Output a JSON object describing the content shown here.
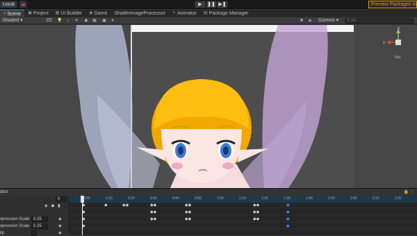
{
  "toolbar": {
    "local_label": "Local",
    "cloud_icon": "cloud-icon",
    "play_icon": "▶",
    "pause_icon": "❚❚",
    "step_icon": "▶❚",
    "preview_label": "Preview Packages in Us"
  },
  "tabs": [
    {
      "label": "Scene",
      "icon": "#"
    },
    {
      "label": "Project",
      "icon": "▣"
    },
    {
      "label": "UI Builder",
      "icon": "▦"
    },
    {
      "label": "Game",
      "icon": "◉"
    },
    {
      "label": "ShaderImageProcessor",
      "icon": ""
    },
    {
      "label": "Animator",
      "icon": "✎"
    },
    {
      "label": "Package Manager",
      "icon": "▤"
    }
  ],
  "scenebar": {
    "shading_mode": "Shaded",
    "mode_2d": "2D",
    "gizmos_label": "Gizmos",
    "search_placeholder": "All"
  },
  "viewport": {
    "projection_label": "Iso",
    "axis_x": "x",
    "axis_y": "y"
  },
  "timeline": {
    "header_label": "ditor",
    "frame_value": "0",
    "properties": [
      {
        "label": "xpression Scale",
        "value": "0.25"
      },
      {
        "label": "xpression Scale",
        "value": "0.25"
      },
      {
        "label": "lip",
        "value": ""
      }
    ],
    "ruler_ticks": [
      "0:00",
      "0:10",
      "0:20",
      "0:30",
      "0:40",
      "0:50",
      "1:00",
      "1:10",
      "1:20",
      "1:30",
      "1:40",
      "1:50",
      "2:00",
      "2:10",
      "2:20"
    ]
  },
  "colors": {
    "accent_blue": "#3a79bb",
    "preview_orange": "#e0a000",
    "key_blue": "#4a8aff"
  }
}
